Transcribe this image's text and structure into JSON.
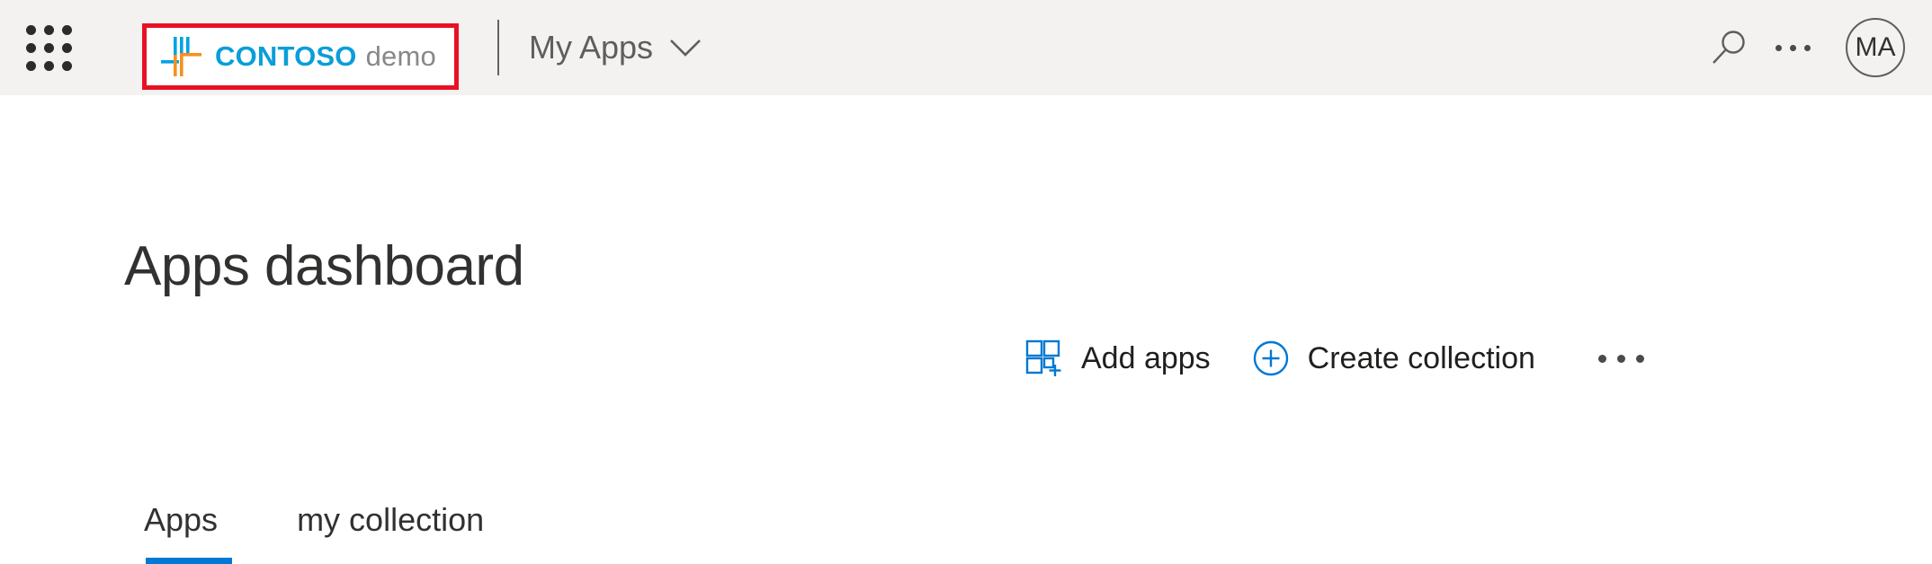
{
  "header": {
    "waffle_icon": "app-launcher-waffle-icon",
    "brand": {
      "logo_icon": "contoso-logo-mark",
      "name": "CONTOSO",
      "sub": "demo",
      "name_color": "#0a9ed9",
      "sub_color": "#8a8886",
      "highlight_color": "#e81123",
      "highlighted": true
    },
    "app_name": "My Apps",
    "app_name_chevron_icon": "chevron-down-icon",
    "search_icon": "search-icon",
    "more_icon": "ellipsis-icon",
    "avatar_initials": "MA"
  },
  "main": {
    "page_title": "Apps dashboard",
    "commands": [
      {
        "label": "Add apps",
        "icon": "add-apps-grid-icon",
        "icon_color": "#0078d4"
      },
      {
        "label": "Create collection",
        "icon": "circle-plus-icon",
        "icon_color": "#0078d4"
      }
    ],
    "overflow_icon": "ellipsis-icon",
    "tabs": [
      {
        "label": "Apps",
        "active": true
      },
      {
        "label": "my collection",
        "active": false
      }
    ],
    "accent_color": "#0078d4"
  }
}
